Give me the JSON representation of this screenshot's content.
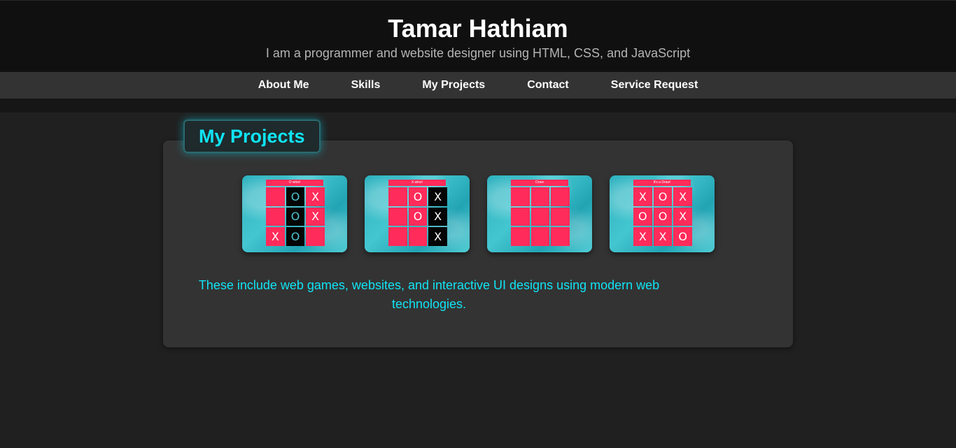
{
  "header": {
    "title": "Tamar Hathiam",
    "tagline": "I am a programmer and website designer using HTML, CSS, and JavaScript"
  },
  "nav": {
    "items": [
      {
        "label": "About Me"
      },
      {
        "label": "Skills"
      },
      {
        "label": "My Projects"
      },
      {
        "label": "Contact"
      },
      {
        "label": "Service Request"
      }
    ]
  },
  "projects": {
    "heading": "My Projects",
    "description": "These include web games, websites, and interactive UI designs using modern web technologies.",
    "thumbnails": [
      {
        "banner": "O wins!",
        "cells": [
          "",
          "O",
          "X",
          "",
          "O",
          "X",
          "X",
          "O",
          ""
        ]
      },
      {
        "banner": "X wins!",
        "cells": [
          "",
          "O",
          "X",
          "",
          "O",
          "X",
          "",
          "",
          "X"
        ]
      },
      {
        "banner": "Draw",
        "cells": [
          "",
          "",
          "",
          "",
          "",
          "",
          "",
          "",
          ""
        ]
      },
      {
        "banner": "It's a Draw!",
        "cells": [
          "X",
          "O",
          "X",
          "O",
          "O",
          "X",
          "X",
          "X",
          "O"
        ]
      }
    ]
  },
  "colors": {
    "accent": "#10e4f4",
    "board_red": "#ff2b5a",
    "card_bg": "#333333",
    "page_bg": "#202020"
  }
}
